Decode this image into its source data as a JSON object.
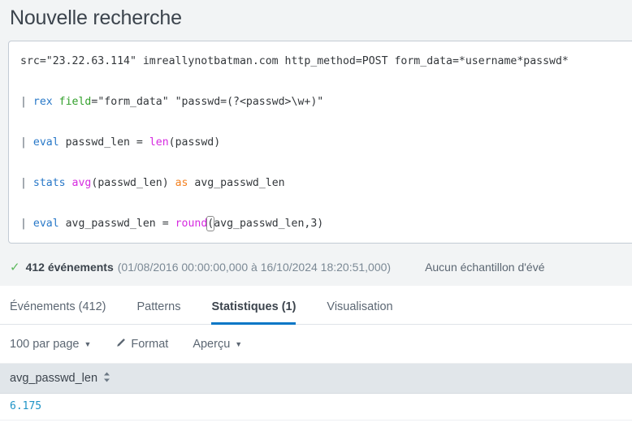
{
  "page_title": "Nouvelle recherche",
  "search": {
    "name": "spl-query-editor",
    "lines": [
      {
        "tokens": [
          {
            "text": "src=\"23.22.63.114\" imreallynotbatman.com http_method=POST form_data=*username*passwd*",
            "type": "plain"
          }
        ]
      },
      {
        "tokens": [
          {
            "text": "| ",
            "type": "pipe"
          },
          {
            "text": "rex",
            "type": "cmd"
          },
          {
            "text": " ",
            "type": "plain"
          },
          {
            "text": "field",
            "type": "field"
          },
          {
            "text": "=\"form_data\" \"passwd=(?<passwd>\\w+)\"",
            "type": "plain"
          }
        ]
      },
      {
        "tokens": [
          {
            "text": "| ",
            "type": "pipe"
          },
          {
            "text": "eval",
            "type": "cmd"
          },
          {
            "text": " passwd_len = ",
            "type": "plain"
          },
          {
            "text": "len",
            "type": "func"
          },
          {
            "text": "(passwd)",
            "type": "plain"
          }
        ]
      },
      {
        "tokens": [
          {
            "text": "| ",
            "type": "pipe"
          },
          {
            "text": "stats",
            "type": "cmd"
          },
          {
            "text": " ",
            "type": "plain"
          },
          {
            "text": "avg",
            "type": "func"
          },
          {
            "text": "(passwd_len) ",
            "type": "plain"
          },
          {
            "text": "as",
            "type": "as"
          },
          {
            "text": " avg_passwd_len",
            "type": "plain"
          }
        ]
      },
      {
        "tokens": [
          {
            "text": "| ",
            "type": "pipe"
          },
          {
            "text": "eval",
            "type": "cmd"
          },
          {
            "text": " avg_passwd_len = ",
            "type": "plain"
          },
          {
            "text": "round",
            "type": "func"
          },
          {
            "text": "(",
            "type": "bracket"
          },
          {
            "text": "avg_passwd_len,3)",
            "type": "plain"
          }
        ]
      }
    ]
  },
  "status": {
    "check_icon": "check-icon",
    "event_count": "412 événements",
    "time_range": "(01/08/2016 00:00:00,000 à 16/10/2024 18:20:51,000)",
    "sample_label": "Aucun échantillon d'évé"
  },
  "tabs": [
    {
      "label": "Événements (412)",
      "name": "tab-evenements",
      "active": false
    },
    {
      "label": "Patterns",
      "name": "tab-patterns",
      "active": false
    },
    {
      "label": "Statistiques (1)",
      "name": "tab-statistiques",
      "active": true
    },
    {
      "label": "Visualisation",
      "name": "tab-visualisation",
      "active": false
    }
  ],
  "toolbar": {
    "per_page_label": "100 par page",
    "format_label": "Format",
    "preview_label": "Aperçu",
    "caret_glyph": "▼"
  },
  "results_table": {
    "columns": [
      {
        "label": "avg_passwd_len",
        "name": "column-header-avg-passwd-len"
      }
    ],
    "rows": [
      {
        "cells": [
          "6.175"
        ]
      }
    ]
  },
  "colors": {
    "accent_blue": "#0877c6",
    "link_blue": "#1e93c6",
    "success_green": "#5cb85c",
    "page_bg": "#f2f4f5",
    "table_header_bg": "#e1e6ea"
  }
}
